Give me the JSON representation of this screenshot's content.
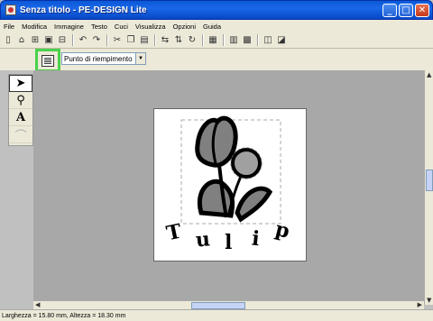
{
  "window": {
    "title": "Senza titolo - PE-DESIGN Lite"
  },
  "menu": [
    "File",
    "Modifica",
    "Immagine",
    "Testo",
    "Cuci",
    "Visualizza",
    "Opzioni",
    "Guida"
  ],
  "sew_type": {
    "selected": "Punto di riempimento"
  },
  "design": {
    "text": "Tulip",
    "letters": [
      "T",
      "u",
      "l",
      "i",
      "p"
    ],
    "colors": {
      "fill": "#808080",
      "outline": "#000000"
    }
  },
  "status": {
    "size": "Larghezza = 15.80 mm, Altezza  = 18.30 mm"
  },
  "colors": {
    "highlight": "#4ad14a",
    "titlebar": "#0a58d8",
    "workspace": "#a8a8a8"
  }
}
